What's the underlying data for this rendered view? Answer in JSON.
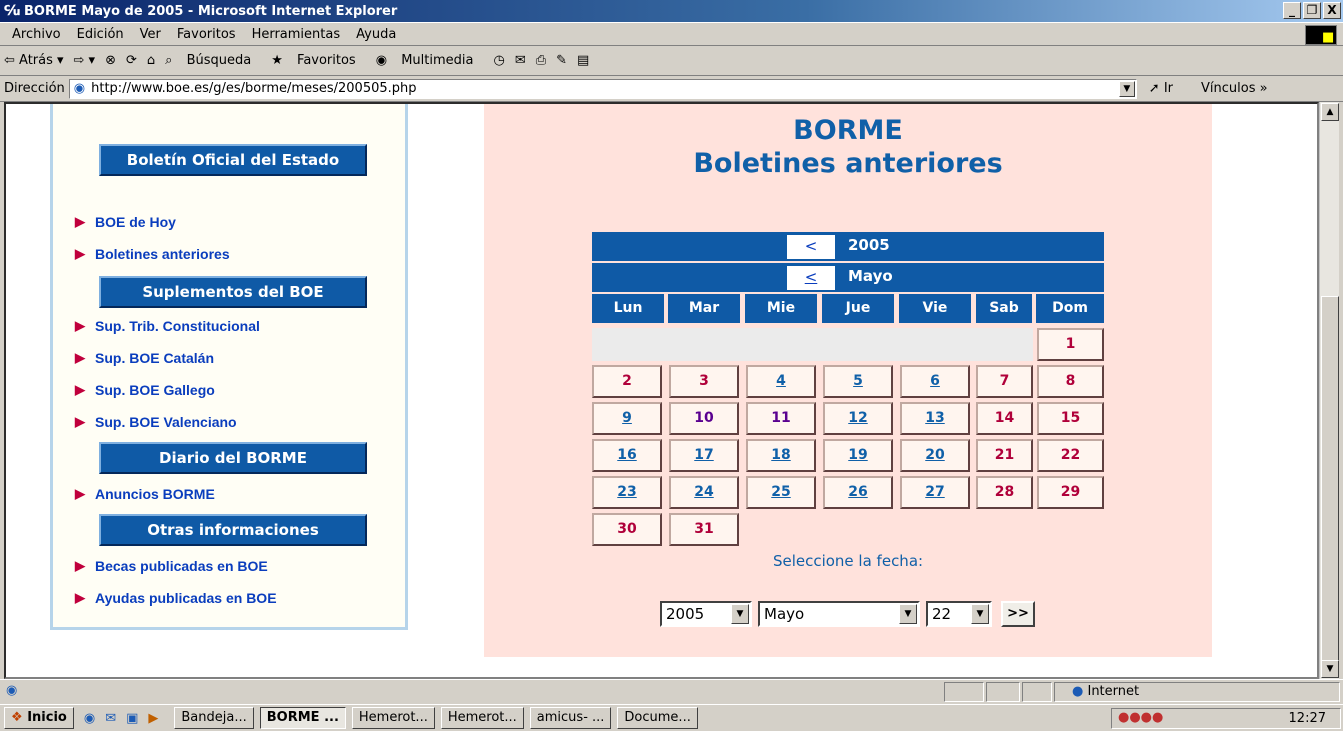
{
  "window": {
    "title": "BORME Mayo de 2005 - Microsoft Internet Explorer",
    "controls": [
      "_",
      "❐",
      "X"
    ]
  },
  "menu": [
    "Archivo",
    "Edición",
    "Ver",
    "Favoritos",
    "Herramientas",
    "Ayuda"
  ],
  "toolbar": {
    "back": "⇦ Atrás ▾",
    "forward": "⇨ ▾",
    "stop": "⊗",
    "refresh": "⟳",
    "home": "⌂",
    "search": "Búsqueda",
    "favorites": "Favoritos",
    "media": "Multimedia"
  },
  "address": {
    "label": "Dirección",
    "url": "http://www.boe.es/g/es/borme/meses/200505.php",
    "go": "Ir",
    "links": "Vínculos »"
  },
  "sidebar": {
    "heading1": "Boletín Oficial del Estado",
    "links1": [
      "BOE de Hoy",
      "Boletines anteriores"
    ],
    "heading2": "Suplementos del BOE",
    "links2": [
      "Sup. Trib. Constitucional",
      "Sup. BOE Catalán",
      "Sup. BOE Gallego",
      "Sup. BOE Valenciano"
    ],
    "heading3": "Diario del BORME",
    "links3": [
      "Anuncios BORME"
    ],
    "heading4": "Otras informaciones",
    "links4": [
      "Becas publicadas en BOE",
      "Ayudas publicadas en BOE"
    ]
  },
  "main": {
    "title1": "BORME",
    "title2": "Boletines anteriores",
    "calendar": {
      "year": "2005",
      "year_prev": "<",
      "month": "Mayo",
      "month_prev": "<",
      "weekdays": [
        "Lun",
        "Mar",
        "Mie",
        "Jue",
        "Vie",
        "Sab",
        "Dom"
      ],
      "days": {
        "d1": "1",
        "d2": "2",
        "d3": "3",
        "d4": "4",
        "d5": "5",
        "d6": "6",
        "d7": "7",
        "d8": "8",
        "d9": "9",
        "d10": "10",
        "d11": "11",
        "d12": "12",
        "d13": "13",
        "d14": "14",
        "d15": "15",
        "d16": "16",
        "d17": "17",
        "d18": "18",
        "d19": "19",
        "d20": "20",
        "d21": "21",
        "d22": "22",
        "d23": "23",
        "d24": "24",
        "d25": "25",
        "d26": "26",
        "d27": "27",
        "d28": "28",
        "d29": "29",
        "d30": "30",
        "d31": "31"
      }
    },
    "select_label": "Seleccione la fecha:",
    "select_year": "2005",
    "select_month": "Mayo",
    "select_day": "22",
    "go_button": ">>"
  },
  "status": {
    "zone": "Internet"
  },
  "taskbar": {
    "start": "Inicio",
    "buttons": [
      "Bandeja...",
      "BORME ...",
      "Hemerot...",
      "Hemerot...",
      "amicus- ...",
      "Docume..."
    ],
    "clock": "12:27"
  },
  "colors": {
    "accent": "#0f5aa6",
    "panel": "#ffe2dc",
    "link": "#1060a8",
    "weekend": "#b0003a"
  }
}
